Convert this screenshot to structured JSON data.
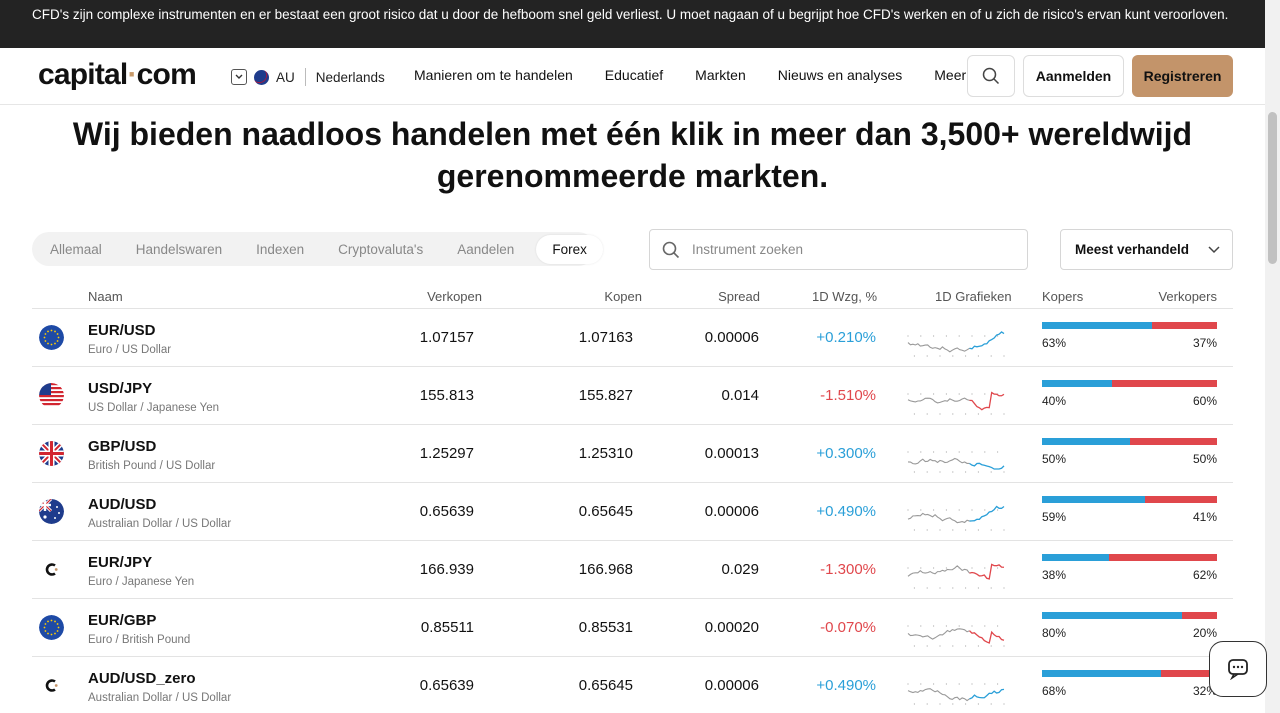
{
  "risk_banner": "CFD's zijn complexe instrumenten en er bestaat een groot risico dat u door de hefboom snel geld verliest. U moet nagaan of u begrijpt hoe CFD's werken en of u zich de risico's ervan kunt veroorloven.",
  "header": {
    "logo_left": "capital",
    "logo_right": "com",
    "region_code": "AU",
    "language": "Nederlands",
    "nav": [
      "Manieren om te handelen",
      "Educatief",
      "Markten",
      "Nieuws en analyses",
      "Meer"
    ],
    "login": "Aanmelden",
    "register": "Registreren"
  },
  "hero": {
    "line1": "Wij bieden naadloos handelen met één klik in meer dan 3,500+ wereldwijd",
    "line2": "gerenommeerde markten."
  },
  "filters": {
    "tabs": [
      "Allemaal",
      "Handelswaren",
      "Indexen",
      "Cryptovaluta's",
      "Aandelen",
      "Forex"
    ],
    "active_tab": "Forex",
    "search_placeholder": "Instrument zoeken",
    "sort": "Meest verhandeld"
  },
  "table": {
    "headers": {
      "name": "Naam",
      "sell": "Verkopen",
      "buy": "Kopen",
      "spread": "Spread",
      "change": "1D Wzg, %",
      "chart": "1D Grafieken",
      "buyers": "Kopers",
      "sellers": "Verkopers"
    },
    "rows": [
      {
        "symbol": "EUR/USD",
        "name": "Euro / US Dollar",
        "sell": "1.07157",
        "buy": "1.07163",
        "spread": "0.00006",
        "change": "+0.210%",
        "trend": "up",
        "buyers": "63%",
        "sellers": "37%",
        "buyers_pct": 63,
        "icon": "eu-flag-icon"
      },
      {
        "symbol": "USD/JPY",
        "name": "US Dollar / Japanese Yen",
        "sell": "155.813",
        "buy": "155.827",
        "spread": "0.014",
        "change": "-1.510%",
        "trend": "down",
        "buyers": "40%",
        "sellers": "60%",
        "buyers_pct": 40,
        "icon": "us-flag-icon"
      },
      {
        "symbol": "GBP/USD",
        "name": "British Pound / US Dollar",
        "sell": "1.25297",
        "buy": "1.25310",
        "spread": "0.00013",
        "change": "+0.300%",
        "trend": "up",
        "buyers": "50%",
        "sellers": "50%",
        "buyers_pct": 50,
        "icon": "uk-flag-icon"
      },
      {
        "symbol": "AUD/USD",
        "name": "Australian Dollar / US Dollar",
        "sell": "0.65639",
        "buy": "0.65645",
        "spread": "0.00006",
        "change": "+0.490%",
        "trend": "up",
        "buyers": "59%",
        "sellers": "41%",
        "buyers_pct": 59,
        "icon": "au-flag-icon"
      },
      {
        "symbol": "EUR/JPY",
        "name": "Euro / Japanese Yen",
        "sell": "166.939",
        "buy": "166.968",
        "spread": "0.029",
        "change": "-1.300%",
        "trend": "down",
        "buyers": "38%",
        "sellers": "62%",
        "buyers_pct": 38,
        "icon": "capital-logo-icon"
      },
      {
        "symbol": "EUR/GBP",
        "name": "Euro / British Pound",
        "sell": "0.85511",
        "buy": "0.85531",
        "spread": "0.00020",
        "change": "-0.070%",
        "trend": "down",
        "buyers": "80%",
        "sellers": "20%",
        "buyers_pct": 80,
        "icon": "eu-flag-icon"
      },
      {
        "symbol": "AUD/USD_zero",
        "name": "Australian Dollar / US Dollar",
        "sell": "0.65639",
        "buy": "0.65645",
        "spread": "0.00006",
        "change": "+0.490%",
        "trend": "up",
        "buyers": "68%",
        "sellers": "32%",
        "buyers_pct": 68,
        "icon": "capital-logo-icon"
      }
    ]
  },
  "colors": {
    "accent": "#c3946a",
    "up": "#2a9fd8",
    "down": "#e0474c",
    "banner": "#232323"
  }
}
